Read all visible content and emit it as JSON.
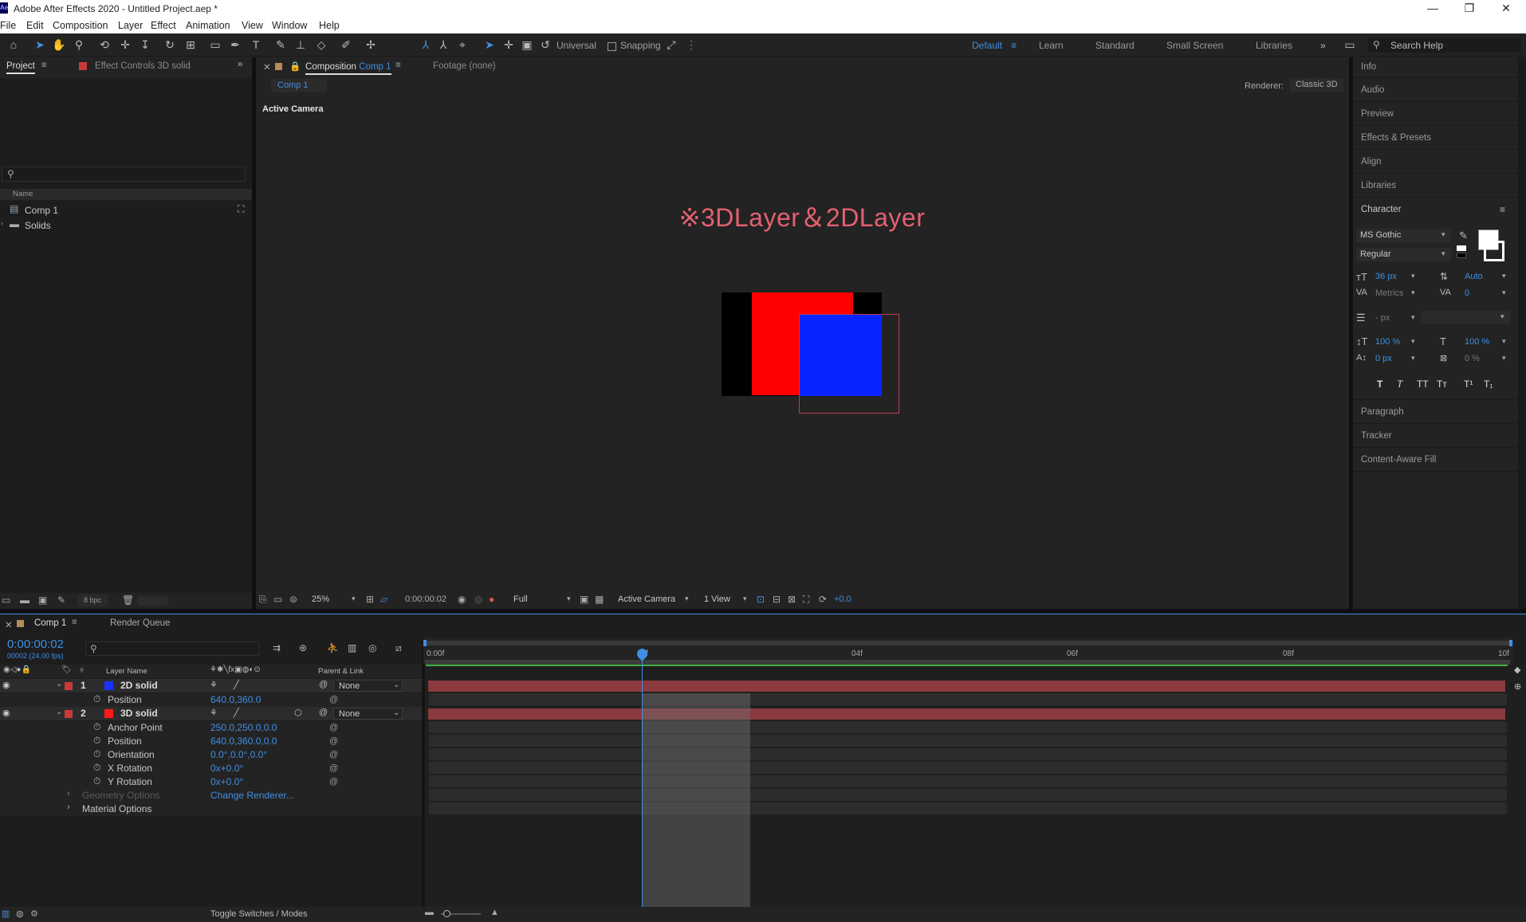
{
  "window": {
    "title": "Adobe After Effects 2020 - Untitled Project.aep *",
    "app_badge": "Ae",
    "minimize": "—",
    "maximize": "❐",
    "close": "✕"
  },
  "menu": [
    "File",
    "Edit",
    "Composition",
    "Layer",
    "Effect",
    "Animation",
    "View",
    "Window",
    "Help"
  ],
  "toolbar": {
    "axis_mode": "Universal",
    "snapping_label": "Snapping",
    "workspaces": [
      "Default",
      "Learn",
      "Standard",
      "Small Screen",
      "Libraries"
    ],
    "active_workspace": "Default",
    "search_placeholder": "Search Help"
  },
  "project_panel": {
    "tab_project": "Project",
    "tab_effect_controls": "Effect Controls 3D solid",
    "column_name": "Name",
    "items": [
      "Comp 1",
      "Solids"
    ],
    "bpc": "8 bpc"
  },
  "comp_panel": {
    "tab_label": "Composition",
    "tab_comp_name": "Comp 1",
    "footage_tab": "Footage (none)",
    "comp_chip": "Comp 1",
    "renderer_label": "Renderer:",
    "renderer_value": "Classic 3D",
    "camera_label": "Active Camera",
    "canvas_text": "※3DLayer＆2DLayer",
    "zoom": "25%",
    "timecode": "0:00:00:02",
    "resolution": "Full",
    "view_camera": "Active Camera",
    "view_layout": "1 View",
    "exposure": "+0.0"
  },
  "right_panel": {
    "items": [
      "Info",
      "Audio",
      "Preview",
      "Effects & Presets",
      "Align",
      "Libraries"
    ],
    "character_title": "Character",
    "font_family": "MS Gothic",
    "font_style": "Regular",
    "font_size": "36 px",
    "leading": "Auto",
    "kerning": "Metrics",
    "tracking": "0",
    "stroke_width": "- px",
    "vert_scale": "100 %",
    "horiz_scale": "100 %",
    "baseline": "0 px",
    "tsume": "0 %",
    "style_buttons": [
      "T",
      "T",
      "TT",
      "Tт",
      "T¹",
      "T₁"
    ],
    "bottom_items": [
      "Paragraph",
      "Tracker",
      "Content-Aware Fill"
    ]
  },
  "timeline": {
    "tab_comp": "Comp 1",
    "tab_render": "Render Queue",
    "current_time": "0:00:00:02",
    "frame_info": "00002 (24.00 fps)",
    "col_layer_name": "Layer Name",
    "col_parent": "Parent & Link",
    "ruler_labels": [
      "0:00f",
      "02f",
      "04f",
      "06f",
      "08f",
      "10f"
    ],
    "layers": [
      {
        "num": "1",
        "name": "2D solid",
        "color": "#1a32ff",
        "parent": "None"
      },
      {
        "num": "2",
        "name": "3D solid",
        "color": "#ff1a1a",
        "parent": "None"
      }
    ],
    "layer1_props": [
      {
        "name": "Position",
        "value": "640.0,360.0"
      }
    ],
    "layer2_props": [
      {
        "name": "Anchor Point",
        "value": "250.0,250.0,0.0"
      },
      {
        "name": "Position",
        "value": "640.0,360.0,0.0"
      },
      {
        "name": "Orientation",
        "value": "0.0°,0.0°,0.0°"
      },
      {
        "name": "X Rotation",
        "value": "0x+0.0°"
      },
      {
        "name": "Y Rotation",
        "value": "0x+0.0°"
      }
    ],
    "geometry_options": "Geometry Options",
    "change_renderer": "Change Renderer...",
    "material_options": "Material Options",
    "toggle_label": "Toggle Switches / Modes"
  },
  "colors": {
    "accent": "#3f8fe5",
    "red_layer": "#ff0000",
    "blue_layer": "#0a24ff",
    "label_red": "#c83a3a"
  }
}
